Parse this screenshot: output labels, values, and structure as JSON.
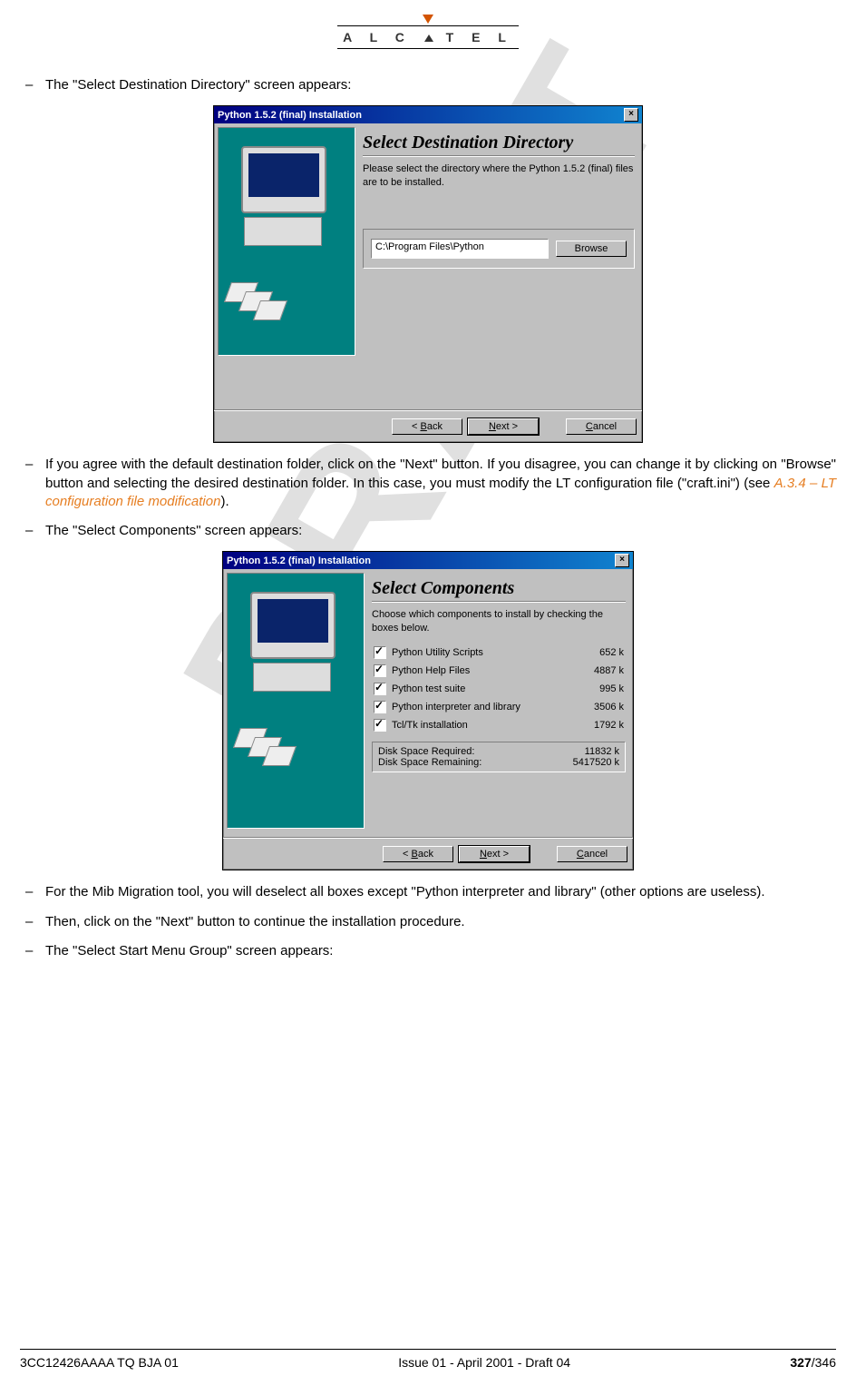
{
  "logo_text": "A L C A T E L",
  "bullets": {
    "b1": "The \"Select Destination Directory\" screen appears:",
    "b2_pre": "If you agree with the default destination folder, click on the \"Next\" button. If you disagree, you can change it by clicking on \"Browse\" button and selecting the desired destination folder. In this case, you must modify the LT configuration file (\"craft.ini\") (see ",
    "b2_ref": "A.3.4 – LT configuration file modification",
    "b2_post": ").",
    "b3": "The \"Select Components\" screen appears:",
    "b4": "For the Mib Migration tool, you will deselect all boxes except \"Python interpreter and library\" (other options are useless).",
    "b5": "Then, click on the \"Next\" button to continue the installation procedure.",
    "b6": "The \"Select Start Menu Group\" screen appears:"
  },
  "win1": {
    "title": "Python 1.5.2 (final) Installation",
    "heading": "Select Destination Directory",
    "body": "Please select the directory where the Python 1.5.2 (final) files are to be installed.",
    "path": "C:\\Program Files\\Python",
    "browse": "Browse",
    "back": "< Back",
    "next": "Next >",
    "cancel": "Cancel"
  },
  "win2": {
    "title": "Python 1.5.2 (final) Installation",
    "heading": "Select Components",
    "body": "Choose which components to install by checking the boxes below.",
    "components": [
      {
        "name": "Python Utility Scripts",
        "size": "652 k",
        "checked": true
      },
      {
        "name": "Python Help Files",
        "size": "4887 k",
        "checked": true
      },
      {
        "name": "Python test suite",
        "size": "995 k",
        "checked": true
      },
      {
        "name": "Python interpreter and library",
        "size": "3506 k",
        "checked": true
      },
      {
        "name": "Tcl/Tk installation",
        "size": "1792 k",
        "checked": true
      }
    ],
    "disk_req_label": "Disk Space Required:",
    "disk_req_val": "11832 k",
    "disk_rem_label": "Disk Space Remaining:",
    "disk_rem_val": "5417520 k",
    "back": "< Back",
    "next": "Next >",
    "cancel": "Cancel"
  },
  "footer": {
    "left": "3CC12426AAAA TQ BJA 01",
    "center": "Issue 01 - April 2001 - Draft 04",
    "page_cur": "327",
    "page_total": "/346"
  },
  "watermark": "DRAFT"
}
